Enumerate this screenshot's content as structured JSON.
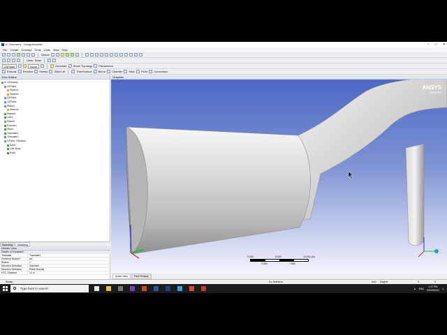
{
  "window": {
    "title": "A: Geometry - DesignModeler",
    "minimize": "–",
    "maximize": "□",
    "close": "✕"
  },
  "menu": [
    "File",
    "Create",
    "Concept",
    "Tools",
    "Units",
    "View",
    "Help"
  ],
  "toolbar1": {
    "select_label": "Select:"
  },
  "toolbar2": {
    "undo_label": "Undo",
    "redo_label": "Redo",
    "plane_value": "ZXPlane",
    "sketch_value": "None"
  },
  "toolbar3": {
    "generate_label": "Generate",
    "share_topology_label": "Share Topology",
    "parameters_label": "Parameters"
  },
  "toolbar4": {
    "extrude_label": "Extrude",
    "revolve_label": "Revolve",
    "sweep_label": "Sweep",
    "skin_label": "Skin/Loft",
    "thin_label": "Thin/Surface",
    "blend_label": "Blend",
    "chamfer_label": "Chamfer",
    "slice_label": "Slice",
    "point_label": "Point",
    "conversion_label": "Conversion"
  },
  "tree": {
    "header": "Tree Outline",
    "nodes": [
      {
        "label": "A: Geometry",
        "color": "b"
      },
      {
        "label": "ZXPlane",
        "color": "b"
      },
      {
        "label": "Sketch1",
        "color": "y"
      },
      {
        "label": "Sketch4",
        "color": "y"
      },
      {
        "label": "ZXPlane",
        "color": "b"
      },
      {
        "label": "YZPlane",
        "color": "b"
      },
      {
        "label": "Plane4",
        "color": "b"
      },
      {
        "label": "Sketch2",
        "color": "y"
      },
      {
        "label": "Sweep1",
        "color": "g"
      },
      {
        "label": "Line1",
        "color": "g"
      },
      {
        "label": "Plane5",
        "color": "b"
      },
      {
        "label": "Extrude1",
        "color": "g"
      },
      {
        "label": "Slice1",
        "color": "g"
      },
      {
        "label": "Translate1",
        "color": "g"
      },
      {
        "label": "Translate2",
        "color": "g"
      },
      {
        "label": "3 Parts, 3 Bodies",
        "color": "b"
      },
      {
        "label": "Solid",
        "color": "g"
      },
      {
        "label": "Line Body",
        "color": "g"
      },
      {
        "label": "Solid",
        "color": "g"
      }
    ]
  },
  "left_tabs": [
    "Sketching",
    "Modeling"
  ],
  "details": {
    "header": "Details View",
    "group": "Details of Translate2",
    "rows": [
      {
        "k": "Translate",
        "v": "Translate2"
      },
      {
        "k": "Preserve Bodies?",
        "v": "No"
      },
      {
        "k": "Bodies",
        "v": "1"
      },
      {
        "k": "Direction Definition",
        "v": "Selection"
      },
      {
        "k": "Direction Selection",
        "v": "Plane Normal"
      },
      {
        "k": "FD1, Distance",
        "v": "12 m"
      }
    ]
  },
  "graphics": {
    "header": "Graphics",
    "brand": "ANSYS",
    "version": "2019 R3",
    "scale": {
      "top": [
        "0.000",
        "5.000",
        "10.000 (m)"
      ],
      "bottom": [
        "2.500",
        "7.500"
      ]
    },
    "tabs": [
      "Model View",
      "Print Preview"
    ]
  },
  "status": {
    "state": "Ready",
    "selection": "No Selection",
    "units_length": "Inch",
    "units_angle": "Degree",
    "val1": "0",
    "val2": "0"
  },
  "taskbar": {
    "search_placeholder": "Type here to search",
    "app_colors": [
      "#e8e8e8",
      "#f0c040",
      "#777777",
      "#7a3fbf",
      "#d24726",
      "#2b579a",
      "#1f3e8c",
      "#2ca5e0",
      "#d84a3a",
      "#c23c2a"
    ],
    "lang": "ENG",
    "time": "1:47 PM",
    "date": "2020/02/03"
  }
}
